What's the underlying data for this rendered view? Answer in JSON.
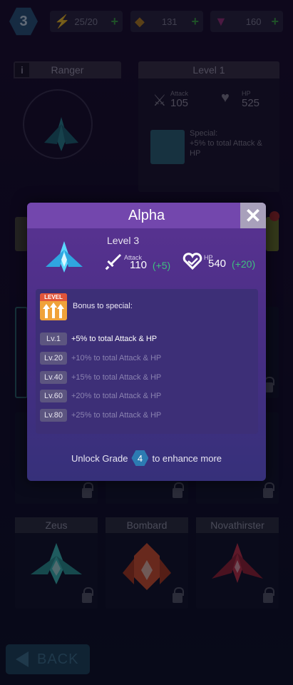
{
  "topbar": {
    "player_level": "3",
    "energy": "25/20",
    "gold": "131",
    "gems": "160"
  },
  "background": {
    "ship_name": "Ranger",
    "level_header": "Level 1",
    "attack_label": "Attack",
    "attack_value": "105",
    "hp_label": "HP",
    "hp_value": "525",
    "special_text": "Special:\n+5% to total Attack & HP"
  },
  "cards": [
    {
      "name": "Zeus",
      "color": "#3fc7c0"
    },
    {
      "name": "Bombard",
      "color": "#e0572f"
    },
    {
      "name": "Novathirster",
      "color": "#c9344a"
    }
  ],
  "back_label": "BACK",
  "modal": {
    "title": "Alpha",
    "level": "Level 3",
    "attack_label": "Attack",
    "attack_value": "110",
    "attack_bonus": "(+5)",
    "hp_label": "HP",
    "hp_value": "540",
    "hp_bonus": "(+20)",
    "badge_text": "LEVEL",
    "bonus_title": "Bonus to special:",
    "levels": [
      {
        "lv": "Lv.1",
        "desc": "+5% to total Attack & HP",
        "active": true
      },
      {
        "lv": "Lv.20",
        "desc": "+10% to total Attack & HP",
        "active": false
      },
      {
        "lv": "Lv.40",
        "desc": "+15% to total Attack & HP",
        "active": false
      },
      {
        "lv": "Lv.60",
        "desc": "+20% to total Attack & HP",
        "active": false
      },
      {
        "lv": "Lv.80",
        "desc": "+25% to total Attack & HP",
        "active": false
      }
    ],
    "unlock_prefix": "Unlock Grade",
    "unlock_grade": "4",
    "unlock_suffix": "to enhance more"
  }
}
